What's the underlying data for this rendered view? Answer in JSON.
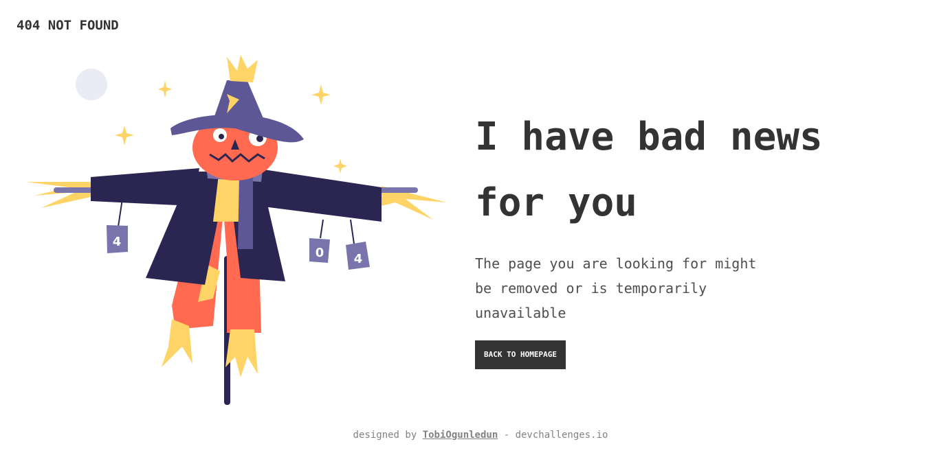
{
  "brand": {
    "text": "404 NOT FOUND"
  },
  "main": {
    "headline": "I have bad news for you",
    "message": "The page you are looking for might be removed or is temporarily unavailable",
    "button_label": "BACK TO HOMEPAGE"
  },
  "illustration": {
    "can_labels": [
      "4",
      "0",
      "4"
    ],
    "icon": "scarecrow-illustration"
  },
  "footer": {
    "prefix": "designed by",
    "author": "TobiOgunledun",
    "separator": " - ",
    "site": "devchallenges.io"
  },
  "colors": {
    "text": "#333333",
    "muted": "#828282",
    "button_bg": "#333333",
    "hat": "#5d5895",
    "coat": "#2b2551",
    "face": "#ff6a51",
    "straw": "#ffd466",
    "moon": "#e9ebf5"
  }
}
